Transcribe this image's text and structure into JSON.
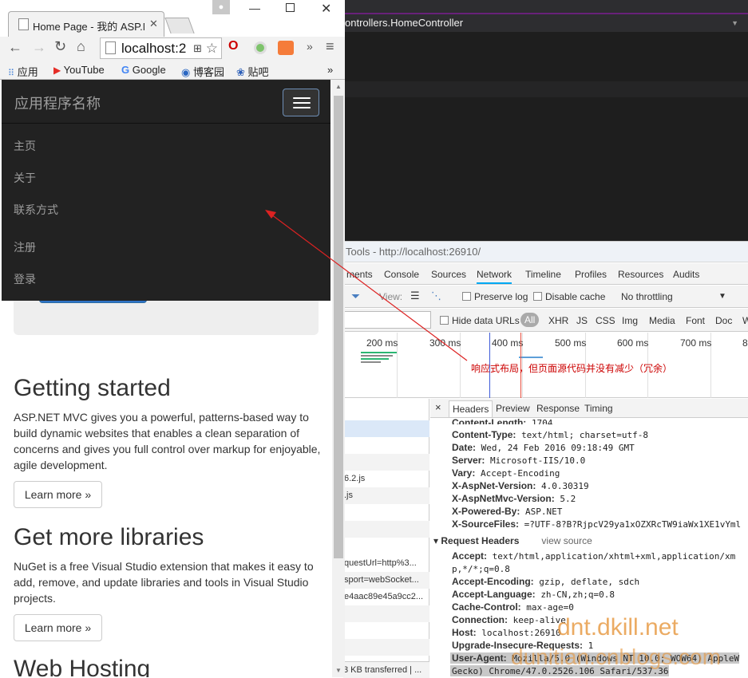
{
  "browser": {
    "tab_title": "Home Page - 我的 ASP.N",
    "url": "localhost:2",
    "bookmarks": [
      "应用",
      "YouTube",
      "Google",
      "博客园",
      "贴吧"
    ],
    "bookmarks_more": "»",
    "ext_more": "»"
  },
  "vs": {
    "tab_text": "ontrollers.HomeController"
  },
  "page": {
    "brand": "应用程序名称",
    "nav_items": [
      "主页",
      "关于",
      "联系方式",
      "注册",
      "登录"
    ],
    "sections": [
      {
        "heading": "Getting started",
        "text": "ASP.NET MVC gives you a powerful, patterns-based way to build dynamic websites that enables a clean separation of concerns and gives you full control over markup for enjoyable, agile development.",
        "button": "Learn more »"
      },
      {
        "heading": "Get more libraries",
        "text": "NuGet is a free Visual Studio extension that makes it easy to add, remove, and update libraries and tools in Visual Studio projects.",
        "button": "Learn more »"
      },
      {
        "heading": "Web Hosting"
      }
    ]
  },
  "devtools": {
    "title": "Tools - http://localhost:26910/",
    "tabs": [
      "ments",
      "Console",
      "Sources",
      "Network",
      "Timeline",
      "Profiles",
      "Resources",
      "Audits"
    ],
    "active_tab": "Network",
    "toolbar": {
      "view_label": "View:",
      "preserve_log": "Preserve log",
      "disable_cache": "Disable cache",
      "throttling": "No throttling"
    },
    "filter": {
      "hide_data_urls": "Hide data URLs",
      "types": [
        "All",
        "XHR",
        "JS",
        "CSS",
        "Img",
        "Media",
        "Font",
        "Doc",
        "W"
      ]
    },
    "timeline_ticks": [
      "200 ms",
      "300 ms",
      "400 ms",
      "500 ms",
      "600 ms",
      "700 ms",
      "8"
    ],
    "annotation": "响应式布局，但页面源代码并没有减少（冗余）",
    "request_list": [
      "",
      "",
      "",
      "",
      "6.2.js",
      ".js",
      "",
      "",
      "questUrl=http%3...",
      "sport=webSocket...",
      "e4aac89e45a9cc2..."
    ],
    "footer": "3 KB transferred | ...",
    "panel_tabs": [
      "Headers",
      "Preview",
      "Response",
      "Timing"
    ],
    "response_headers": [
      {
        "name": "Content-Length:",
        "value": "1704"
      },
      {
        "name": "Content-Type:",
        "value": "text/html; charset=utf-8"
      },
      {
        "name": "Date:",
        "value": "Wed, 24 Feb 2016 09:18:49 GMT"
      },
      {
        "name": "Server:",
        "value": "Microsoft-IIS/10.0"
      },
      {
        "name": "Vary:",
        "value": "Accept-Encoding"
      },
      {
        "name": "X-AspNet-Version:",
        "value": "4.0.30319"
      },
      {
        "name": "X-AspNetMvc-Version:",
        "value": "5.2"
      },
      {
        "name": "X-Powered-By:",
        "value": "ASP.NET"
      },
      {
        "name": "X-SourceFiles:",
        "value": "=?UTF-8?B?RjpcV29ya1xOZXRcTW9iaWx1XE1vYml"
      }
    ],
    "request_section": "Request Headers",
    "view_source": "view source",
    "request_headers": [
      {
        "name": "Accept:",
        "value": "text/html,application/xhtml+xml,application/xm"
      },
      {
        "name": "",
        "value": "p,*/*;q=0.8"
      },
      {
        "name": "Accept-Encoding:",
        "value": "gzip, deflate, sdch"
      },
      {
        "name": "Accept-Language:",
        "value": "zh-CN,zh;q=0.8"
      },
      {
        "name": "Cache-Control:",
        "value": "max-age=0"
      },
      {
        "name": "Connection:",
        "value": "keep-alive"
      },
      {
        "name": "Host:",
        "value": "localhost:26910"
      },
      {
        "name": "Upgrade-Insecure-Requests:",
        "value": "1"
      },
      {
        "name": "User-Agent:",
        "value": "Mozilla/5.0 (Windows NT 10.0; WOW64) AppleW"
      },
      {
        "name": "",
        "value": "Gecko) Chrome/47.0.2526.106 Safari/537.36"
      }
    ]
  },
  "watermarks": [
    "dnt.dkill.net",
    "dunitian.cnblogs.com"
  ]
}
